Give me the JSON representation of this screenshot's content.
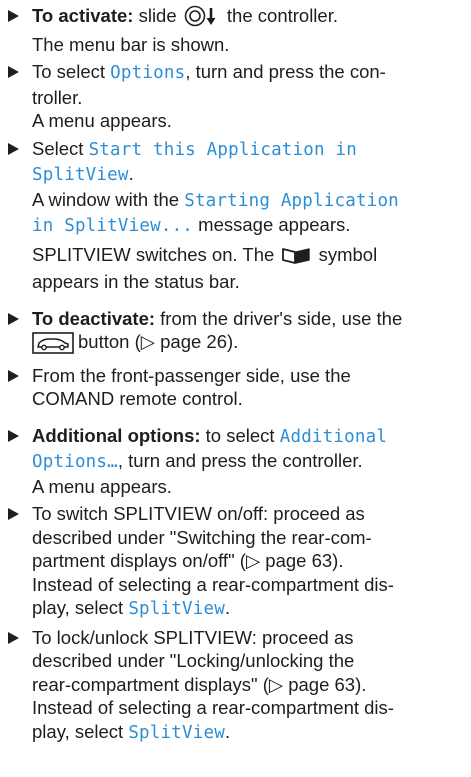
{
  "steps": {
    "s1": {
      "bold": "To activate:",
      "a": " slide",
      "b": " the controller."
    },
    "s1_result": "The menu bar is shown.",
    "s2": {
      "a": "To select ",
      "code": "Options",
      "b": ", turn and press the con-"
    },
    "s2_cont": "troller.",
    "s2_result": "A menu appears.",
    "s3": {
      "a": "Select ",
      "code1": "Start this Application in",
      "code2": "SplitView",
      "b": "."
    },
    "s3_r1": {
      "a": "A window with the ",
      "code1": "Starting Application",
      "code2": "in SplitView...",
      "b": " message appears."
    },
    "s3_r2a": "SPLITVIEW switches on. The",
    "s3_r2b": "symbol",
    "s3_r2c": "appears in the status bar.",
    "s4": {
      "bold": "To deactivate:",
      "a": " from the driver's side, use the",
      "b": "button (",
      "ref": "▷ page 26",
      "c": ")."
    },
    "s5": {
      "a": "From the front-passenger side, use the",
      "b": "COMAND remote control."
    },
    "s6": {
      "bold": "Additional options:",
      "a": " to select ",
      "code1": "Additional",
      "code2": "Options…",
      "b": ", turn and press the controller.",
      "result": "A menu appears."
    },
    "s7": {
      "l1": "To switch SPLITVIEW on/off: proceed as",
      "l2": "described under \"Switching the rear-com-",
      "l3": "partment displays on/off\" (▷ page 63).",
      "l4": "Instead of selecting a rear-compartment dis-",
      "l5": "play, select ",
      "code": "SplitView",
      "end": "."
    },
    "s8": {
      "l1": "To lock/unlock SPLITVIEW: proceed as",
      "l2": "described under \"Locking/unlocking the",
      "l3": "rear-compartment displays\" (▷ page 63).",
      "l4": "Instead of selecting a rear-compartment dis-",
      "l5": "play, select ",
      "code": "SplitView",
      "end": "."
    }
  },
  "icons": [
    "controller-slide-down-icon",
    "status-bar-splitview-icon",
    "vehicle-button-icon",
    "bullet-triangle-icon"
  ],
  "colors": {
    "text": "#1e1e1e",
    "highlight": "#2c8ed6"
  }
}
